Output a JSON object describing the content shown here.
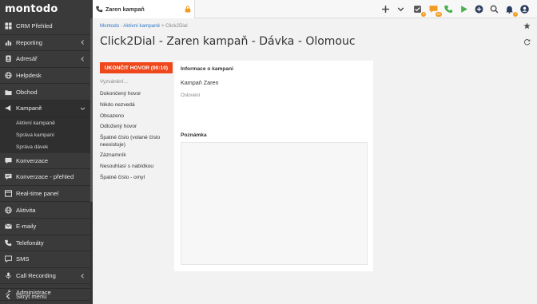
{
  "sidebar": {
    "logo": "montodo",
    "items": [
      {
        "label": "CRM Přehled",
        "icon": "dashboard-icon"
      },
      {
        "label": "Reporting",
        "icon": "chart-icon",
        "chevron": true
      },
      {
        "label": "Adresář",
        "icon": "address-book-icon",
        "chevron": true
      },
      {
        "label": "Helpdesk",
        "icon": "globe-icon"
      },
      {
        "label": "Obchod",
        "icon": "folder-icon"
      },
      {
        "label": "Kampaně",
        "icon": "megaphone-icon",
        "chevron": true,
        "expanded": true
      }
    ],
    "sub_items": [
      "Aktivní kampaně",
      "Správa kampaní",
      "Správa dávek"
    ],
    "items2": [
      {
        "label": "Konverzace",
        "icon": "chat-icon"
      },
      {
        "label": "Konverzace - přehled",
        "icon": "chat-list-icon"
      },
      {
        "label": "Real-time panel",
        "icon": "panel-icon"
      },
      {
        "label": "Aktivita",
        "icon": "globe-icon"
      },
      {
        "label": "E-maily",
        "icon": "mail-icon"
      },
      {
        "label": "Telefonáty",
        "icon": "phone-icon"
      },
      {
        "label": "SMS",
        "icon": "sms-icon"
      },
      {
        "label": "Call Recording",
        "icon": "microphone-icon",
        "chevron": true
      },
      {
        "label": "Administrace",
        "icon": "wrench-icon"
      }
    ],
    "bottom_label": "Skrýt menu"
  },
  "topbar": {
    "tab_label": "Zaren kampaň",
    "badges": {
      "tasks": "1",
      "messages": "22",
      "notifications": "7"
    }
  },
  "content": {
    "breadcrumb": {
      "root": "Montodo",
      "link": "Aktivní kampaně",
      "current": "Click2Dial"
    },
    "title": "Click2Dial - Zaren kampaň - Dávka - Olomouc",
    "end_call_label": "UKONČIT HOVOR (00:10)",
    "calling_label": "Vyzvánění...",
    "outcomes": [
      "Dokončený hovor",
      "Nikdo nezvedá",
      "Obsazeno",
      "Odložený hovor",
      "Špatné číslo (volané číslo neexistuje)",
      "Záznamník",
      "Nesouhlasí s nabídkou",
      "Špatné číslo - omyl"
    ],
    "info_title": "Informace o kampani",
    "campaign_name": "Kampaň Zaren",
    "greeting_label": "Oslovení",
    "note_title": "Poznámka",
    "note_value": ""
  },
  "colors": {
    "sidebar_bg": "#3a3a3a",
    "accent": "#f0471a",
    "link": "#3478c6"
  }
}
